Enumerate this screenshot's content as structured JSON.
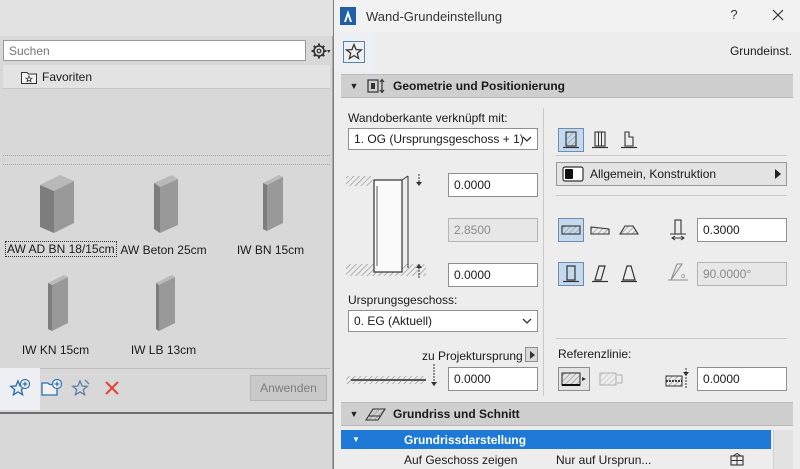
{
  "favorites": {
    "search_placeholder": "Suchen",
    "tree_folder": "Favoriten",
    "items": [
      {
        "label": "AW AD BN 18/15cm",
        "selected": true
      },
      {
        "label": "AW Beton 25cm",
        "selected": false
      },
      {
        "label": "IW BN 15cm",
        "selected": false
      },
      {
        "label": "IW KN 15cm",
        "selected": false
      },
      {
        "label": "IW LB 13cm",
        "selected": false
      }
    ],
    "apply_label": "Anwenden"
  },
  "dialog": {
    "title": "Wand-Grundeinstellung",
    "help_label": "?",
    "preset_name": "Grundeinst.",
    "geometry": {
      "section_title": "Geometrie und Positionierung",
      "top_link_label": "Wandoberkante verknüpft mit:",
      "top_link_value": "1. OG (Ursprungsgeschoss + 1)",
      "top_offset": "0.0000",
      "height": "2.8500",
      "bottom_offset": "0.0000",
      "home_story_label": "Ursprungsgeschoss:",
      "home_story_value": "0. EG (Aktuell)",
      "project_zero_label": "zu Projektursprung",
      "project_zero_value": "0.0000",
      "attribute_label": "Allgemein, Konstruktion",
      "thickness": "0.3000",
      "angle": "90.0000°",
      "reference_line_label": "Referenzlinie:",
      "reference_offset": "0.0000"
    },
    "floor_plan": {
      "section_title": "Grundriss und Schnitt",
      "rows": [
        {
          "label": "Grundrissdarstellung",
          "value": "",
          "selected": true
        },
        {
          "label": "Auf Geschoss zeigen",
          "value": "Nur auf Ursprun...",
          "selected": false
        }
      ]
    }
  },
  "colors": {
    "accent": "#1e78d6",
    "active_button": "#c4d9ee",
    "delete_red": "#e0463a"
  }
}
